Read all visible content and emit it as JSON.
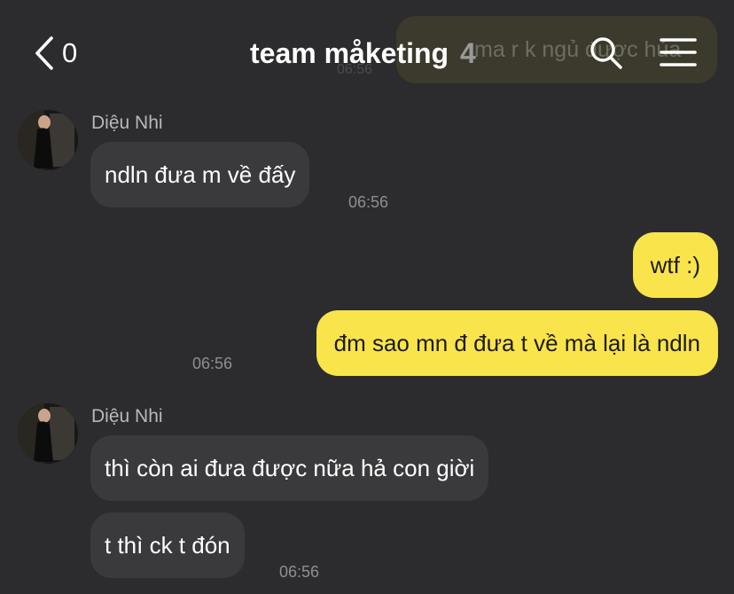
{
  "header": {
    "back_count": "0",
    "title": "team måketing",
    "member_count": "4"
  },
  "background_preview": {
    "text": "ma r k ngủ được hủa",
    "time": "06:56"
  },
  "messages": [
    {
      "sender": "Diệu Nhi",
      "text": "ndln đưa m về đấy",
      "time": "06:56"
    },
    {
      "text": "wtf :)"
    },
    {
      "text": "đm sao mn đ đưa t về mà lại là ndln",
      "time": "06:56"
    },
    {
      "sender": "Diệu Nhi",
      "text": "thì còn ai đưa được nữa hả con giời"
    },
    {
      "text": "t thì ck t đón",
      "time": "06:56"
    }
  ],
  "colors": {
    "background": "#2c2c2e",
    "incoming_bubble": "#3a3a3c",
    "outgoing_bubble": "#f9e44b"
  },
  "icons": [
    "chevron-left-icon",
    "search-icon",
    "hamburger-menu-icon",
    "avatar-photo"
  ]
}
